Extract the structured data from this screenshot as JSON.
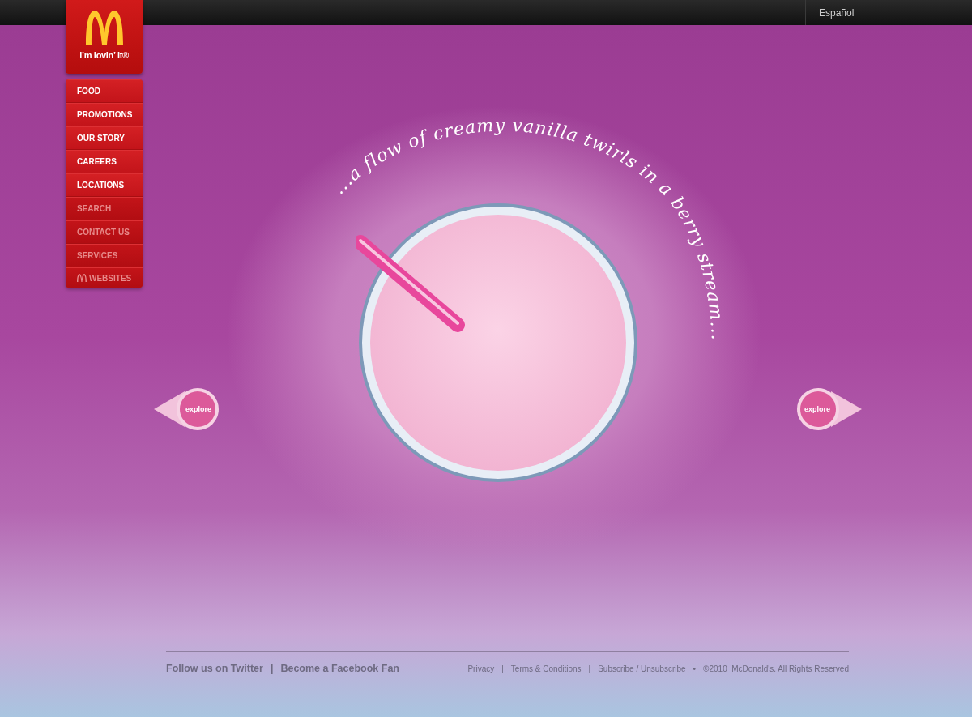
{
  "top_bar": {
    "language_link": "Español"
  },
  "logo": {
    "tagline": "i’m lovin’ it®"
  },
  "nav": [
    {
      "label": "FOOD",
      "kind": "main"
    },
    {
      "label": "PROMOTIONS",
      "kind": "main"
    },
    {
      "label": "OUR STORY",
      "kind": "main"
    },
    {
      "label": "CAREERS",
      "kind": "main"
    },
    {
      "label": "LOCATIONS",
      "kind": "main"
    },
    {
      "label": "SEARCH",
      "kind": "utility"
    },
    {
      "label": "CONTACT US",
      "kind": "utility"
    },
    {
      "label": "SERVICES",
      "kind": "utility"
    },
    {
      "label": "WEBSITES",
      "kind": "brand"
    }
  ],
  "hero": {
    "headline": "...a flow of creamy vanilla twirls in a berry stream...",
    "prev_button": "explore",
    "next_button": "explore"
  },
  "footer": {
    "social_links": [
      "Follow us on Twitter",
      "Become a Facebook Fan"
    ],
    "social_separator": "|",
    "legal_links": [
      "Privacy",
      "Terms & Conditions",
      "Subscribe / Unsubscribe"
    ],
    "legal_separator": "|",
    "copyright_separator": "•",
    "copyright": "©2010  McDonald's. All Rights Reserved"
  }
}
